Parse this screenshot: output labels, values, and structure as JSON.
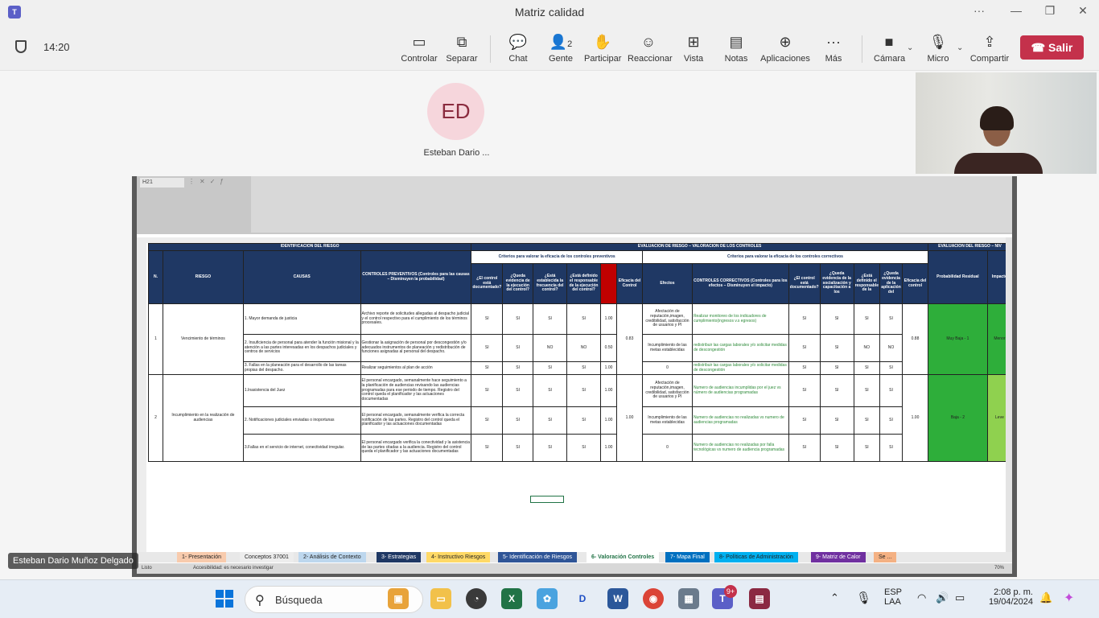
{
  "window": {
    "title": "Matriz calidad",
    "more": "···",
    "minimize": "—",
    "maximize": "❐",
    "close": "✕"
  },
  "toolbar": {
    "time": "14:20",
    "controlar": "Controlar",
    "separar": "Separar",
    "chat": "Chat",
    "gente": "Gente",
    "gente_count": "2",
    "participar": "Participar",
    "reaccionar": "Reaccionar",
    "vista": "Vista",
    "notas": "Notas",
    "aplicaciones": "Aplicaciones",
    "mas": "Más",
    "camara": "Cámara",
    "micro": "Micro",
    "compartir": "Compartir",
    "salir": "Salir"
  },
  "participant": {
    "initials": "ED",
    "name": "Esteban Dario ...",
    "presenter_full_name": "Esteban Dario Muñoz Delgado"
  },
  "excel": {
    "namebox": "H21",
    "section_identificacion": "IDENTIFICACIÓN DEL RIESGO",
    "section_evaluacion": "EVALUACIÓN DE RIESGO – VALORACIÓN DE LOS CONTROLES",
    "section_evaluacion2": "EVALUACIÓN DEL RIESGO – NIV",
    "criterios_prev": "Criterios para valorar la eficacia de los controles preventivos",
    "criterios_corr": "Criterios para valorar la eficacia de los controles correctivos",
    "h_n": "N.",
    "h_riesgo": "RIESGO",
    "h_causas": "CAUSAS",
    "h_prev": "CONTROLES PREVENTIVOS (Controles para las causas – Disminuyen la probabilidad)",
    "h_q1": "¿El control está documentado?",
    "h_q2": "¿Queda evidencia de la ejecución del control?",
    "h_q3": "¿Está establecida la frecuencia del control?",
    "h_q4": "¿Está definido el responsable de la ejecución del control?",
    "h_eficacia": "Eficacia del Control",
    "h_efectos": "Efectos",
    "h_corr": "CONTROLES CORRECTIVOS (Controles para los efectos – Disminuyen el impacto)",
    "h_c1": "¿El control está documentado?",
    "h_c2": "¿Queda evidencia de la socialización y capacitación a los",
    "h_c3": "¿Está definido el responsable de la",
    "h_c4": "¿Queda evidencia de la aplicación del",
    "h_eficacia2": "Eficacia del control",
    "h_prob": "Probabilidad Residual",
    "h_impacto": "Impacto",
    "r1": {
      "n": "1",
      "riesgo": "Vencimiento de términos",
      "causa1": "1. Mayor demanda de justicia",
      "causa2": "2. Insuficiencia de personal para atender la función misional y la atención a las partes interesadas en los despachos judiciales y centros de servicios",
      "causa3": "3. Fallas en la planeación para el desarrollo de las tareas propias del despacho.",
      "prev1": "Archivo reporte de solicitudes allegadas al despacho judicial y el control respectivo para el cumplimiento de los términos procesales.",
      "prev2": "Gestionar la asignación de personal por descongestión y/o adecuados instrumentos de planeación y redistribución de funciones asignadas al personal del despacho.",
      "prev3": "Realizar seguimientos al plan de acción",
      "v1": [
        "SI",
        "SI",
        "SI",
        "SI",
        "1.00"
      ],
      "v2": [
        "SI",
        "SI",
        "NO",
        "NO",
        "0.50"
      ],
      "v3": [
        "SI",
        "SI",
        "SI",
        "SI",
        "1.00"
      ],
      "eficacia": "0.83",
      "efecto1": "Afectación de reputación,imagen, credibilidad, satisfacción de usuarios y PI",
      "efecto2": "Incumplimiento de las metas establecidas",
      "efecto3": "0",
      "corr1": "Realizar monitoreo de los indicadores de cumplimiento(ingresos v.s egresos)",
      "corr2": "redistribuir las cargas laborales y/o solicitar medidas de descongestión",
      "corr3": "redistribuir las cargas laborales y/o solicitar medidas de descongestión",
      "c1": [
        "SI",
        "SI",
        "SI",
        "SI"
      ],
      "c2": [
        "SI",
        "SI",
        "NO",
        "NO"
      ],
      "c3": [
        "SI",
        "SI",
        "SI",
        "SI"
      ],
      "eficacia2": "0.88",
      "prob": "Muy Baja - 1",
      "impacto": "Menor"
    },
    "r2": {
      "n": "2",
      "riesgo": "Incumplimiento en la realización de audiencias",
      "causa1": "1.Inasistencia del Juez",
      "causa2": "2. Notificaciones judiciales enviadas o inoportunas",
      "causa3": "3.Fallas en el servicio de internet, conectividad irregular.",
      "prev1": "El personal encargado, semanalmente hace seguimiento a la planificación de audiencias revisando las audiencias programadas para ese periodo de tiempo. Registro del control queda el planificador y las actuaciones documentadas",
      "prev2": "El personal encargado, semanalmente verifica la correcta notificación de las partes. Registro del control queda el planificador y las actuaciones documentadas",
      "prev3": "El personal encargado verifica la conectividad y la asistencia de las partes citadas a la audiencia. Registro del control queda el planificador y las actuaciones documentadas",
      "v1": [
        "SI",
        "SI",
        "SI",
        "SI",
        "1.00"
      ],
      "v2": [
        "SI",
        "SI",
        "SI",
        "SI",
        "1.00"
      ],
      "v3": [
        "SI",
        "SI",
        "SI",
        "SI",
        "1.00"
      ],
      "eficacia": "1.00",
      "efecto1": "Afectación de reputación,imagen, credibilidad, satisfacción de usuarios y PI",
      "efecto2": "Incumplimiento de las metas establecidas",
      "efecto3": "0",
      "corr1": "Numero de audiencias incumplidas por el juez vs número de audiencias programadas",
      "corr2": "Numero de audiencias no realizadas vs numero de audiencias programadas",
      "corr3": "Numero de audiencias no realizadas por falla tecnológicas vs numero de audiencia programadas",
      "c1": [
        "SI",
        "SI",
        "SI",
        "SI"
      ],
      "c2": [
        "SI",
        "SI",
        "SI",
        "SI"
      ],
      "c3": [
        "SI",
        "SI",
        "SI",
        "SI"
      ],
      "eficacia2": "1.00",
      "prob": "Baja - 2",
      "impacto": "Leve"
    },
    "tabs": [
      "1- Presentación",
      "Conceptos 37001",
      "2- Análisis de Contexto",
      "3- Estrategias",
      "4- Instructivo Riesgos",
      "5- Identificación de Riesgos",
      "6- Valoración Controles",
      "7- Mapa Final",
      "8- Políticas de Administración",
      "9- Matriz de Calor",
      "Se ..."
    ],
    "status": "Listo",
    "accessibility": "Accesibilidad: es necesario investigar",
    "zoom": "70%"
  },
  "taskbar": {
    "search": "Búsqueda",
    "badge": "9+",
    "lang1": "ESP",
    "lang2": "LAA",
    "time": "2:08 p. m.",
    "date": "19/04/2024"
  }
}
